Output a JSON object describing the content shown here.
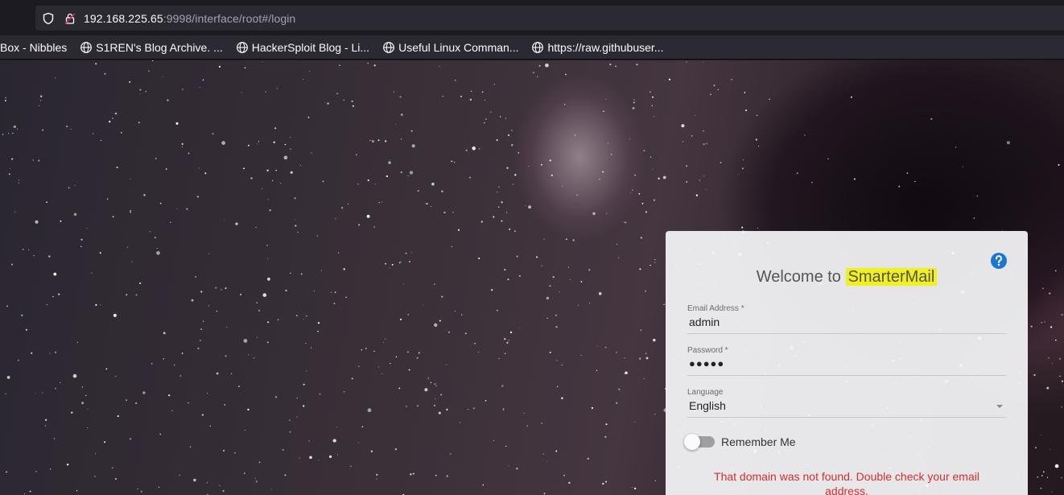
{
  "browser": {
    "url_host": "192.168.225.65",
    "url_rest": ":9998/interface/root#/login",
    "bookmarks": [
      {
        "label": "Box - Nibbles",
        "has_icon": false
      },
      {
        "label": "S1REN's Blog Archive. ...",
        "has_icon": true
      },
      {
        "label": "HackerSploit Blog - Li...",
        "has_icon": true
      },
      {
        "label": "Useful Linux Comman...",
        "has_icon": true
      },
      {
        "label": "https://raw.githubuser...",
        "has_icon": true
      }
    ]
  },
  "login": {
    "welcome_prefix": "Welcome to",
    "brand": "SmarterMail",
    "help_icon": "question-circle-icon",
    "email_label": "Email Address *",
    "email_value": "admin",
    "password_label": "Password *",
    "password_value": "●●●●●",
    "language_label": "Language",
    "language_value": "English",
    "remember_label": "Remember Me",
    "remember_on": false,
    "error": "That domain was not found. Double check your email address."
  },
  "colors": {
    "brand_highlight": "#f0f01e",
    "error": "#d32f2f",
    "help_icon": "#1976d2"
  }
}
